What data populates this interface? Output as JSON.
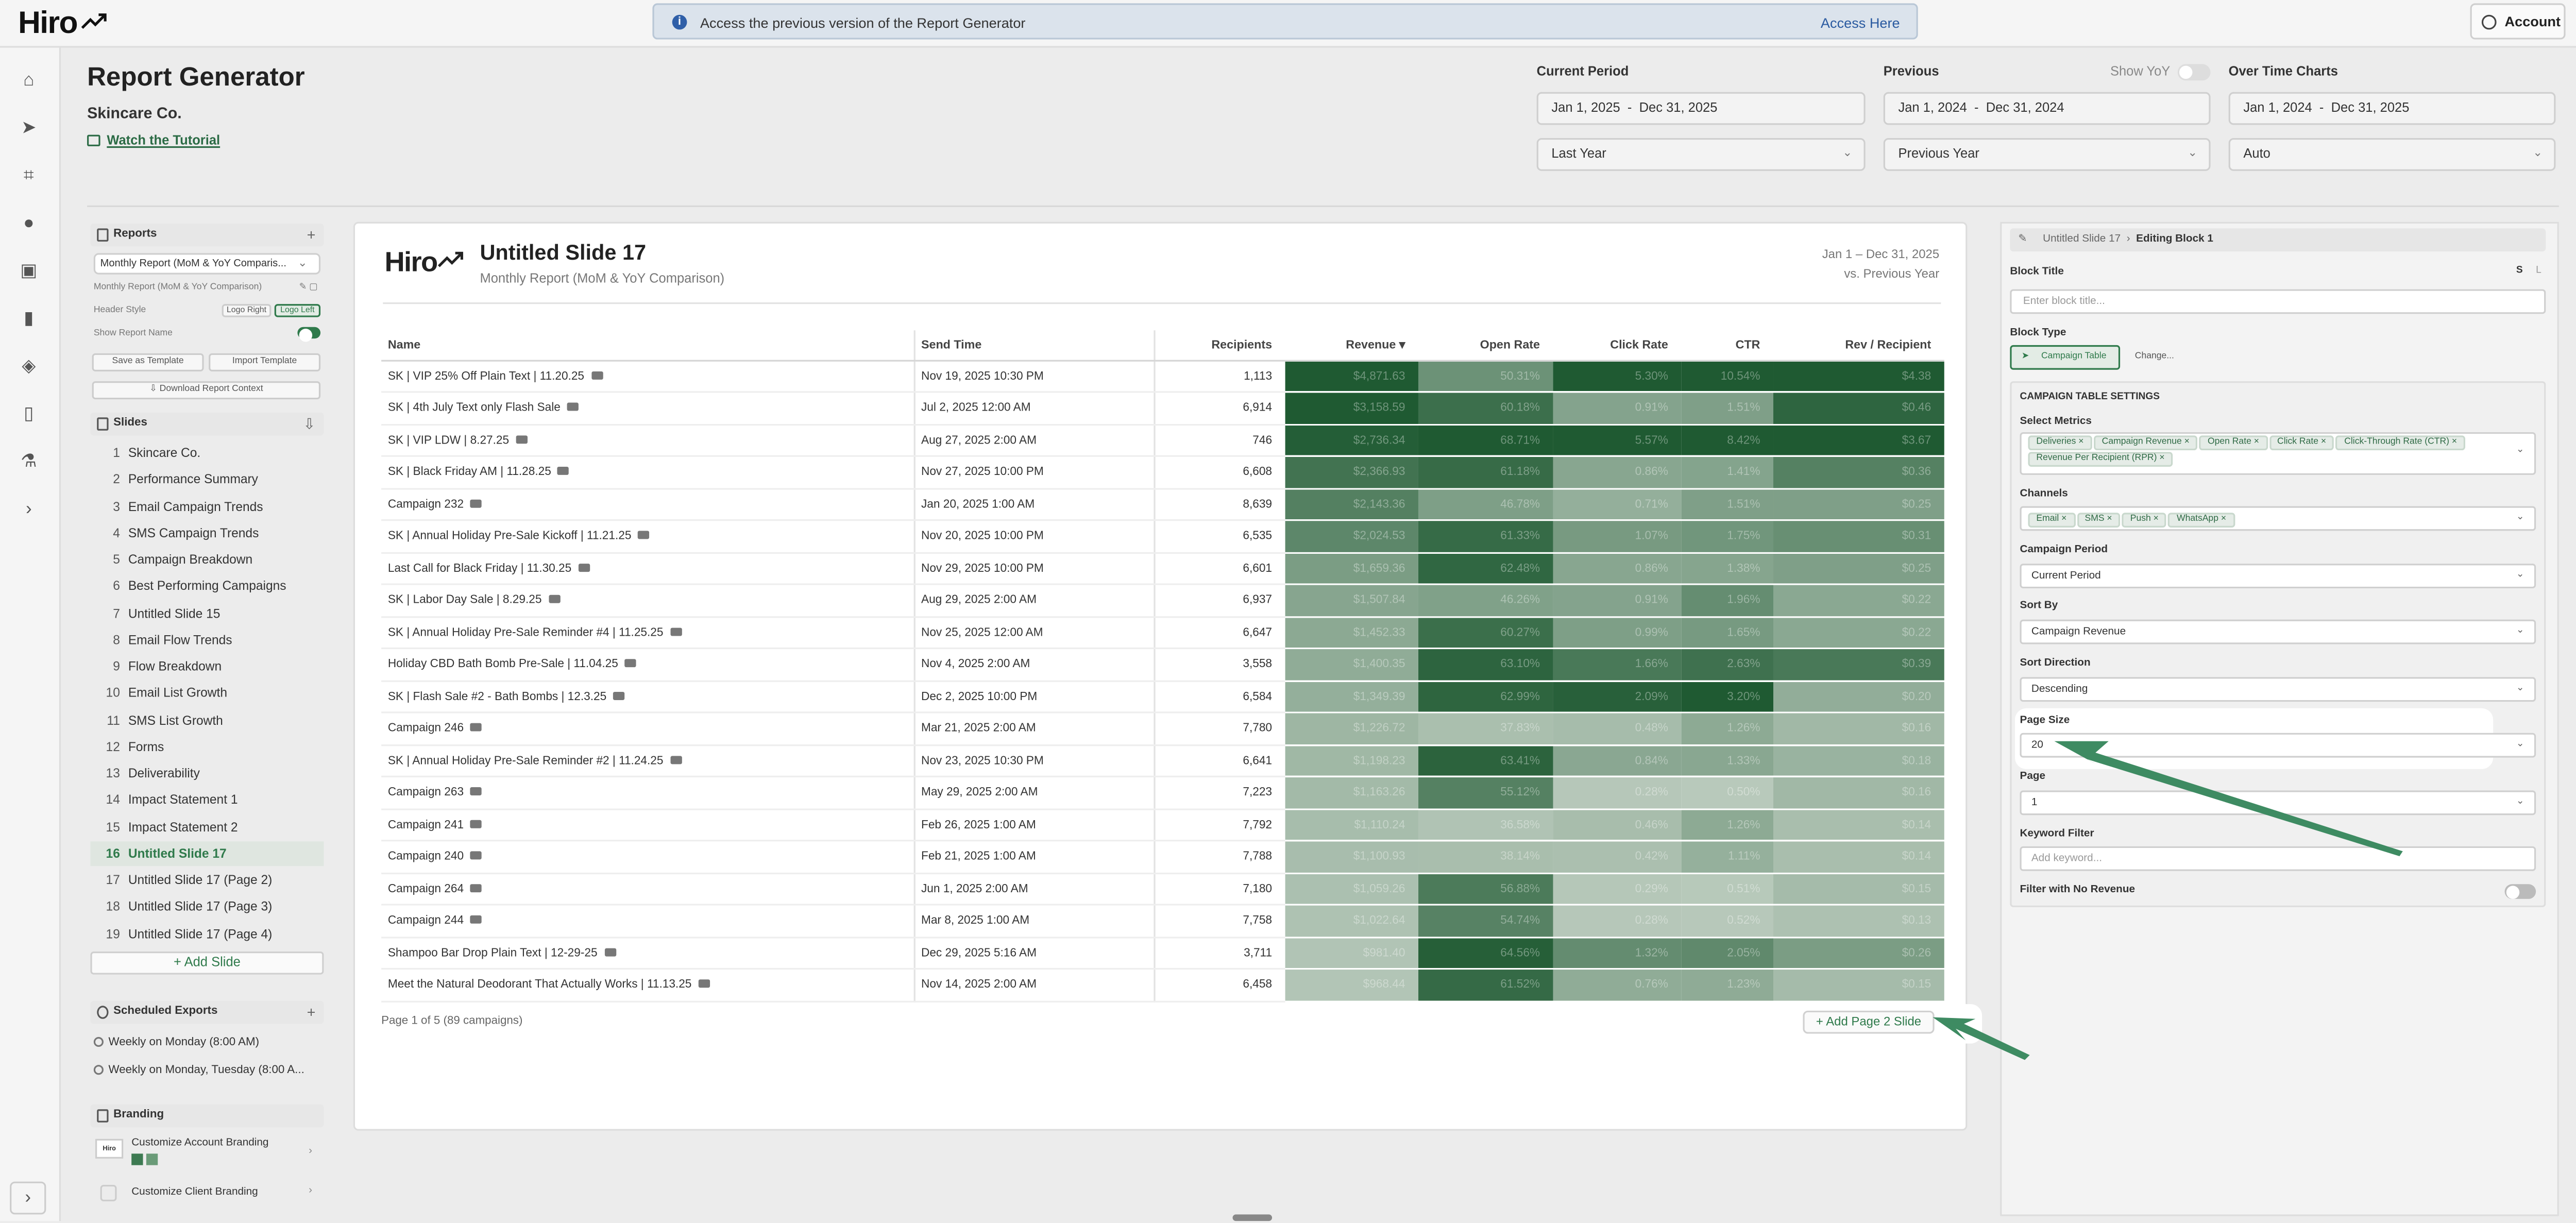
{
  "app": {
    "logo": "Hiro",
    "banner_text": "Access the previous version of the Report Generator",
    "banner_link": "Access Here",
    "account_label": "Account"
  },
  "header": {
    "title": "Report Generator",
    "company": "Skincare Co.",
    "tutorial": "Watch the Tutorial",
    "current_period": {
      "label": "Current Period",
      "start": "Jan 1, 2025",
      "end": "Dec 31, 2025",
      "preset": "Last Year"
    },
    "previous": {
      "label": "Previous",
      "show_yoy": "Show YoY",
      "start": "Jan 1, 2024",
      "end": "Dec 31, 2024",
      "preset": "Previous Year"
    },
    "over_time": {
      "label": "Over Time Charts",
      "start": "Jan 1, 2024",
      "end": "Dec 31, 2025",
      "preset": "Auto"
    }
  },
  "left": {
    "reports_label": "Reports",
    "report_select": "Monthly Report (MoM & YoY Comparis...",
    "report_sub": "Monthly Report (MoM & YoY Comparison)",
    "header_style": "Header Style",
    "logo_right": "Logo Right",
    "logo_left": "Logo Left",
    "show_report_name": "Show Report Name",
    "save_template": "Save as Template",
    "import_template": "Import Template",
    "download_context": "Download Report Context",
    "slides_label": "Slides",
    "slides": [
      {
        "n": "1",
        "label": "Skincare Co."
      },
      {
        "n": "2",
        "label": "Performance Summary"
      },
      {
        "n": "3",
        "label": "Email Campaign Trends"
      },
      {
        "n": "4",
        "label": "SMS Campaign Trends"
      },
      {
        "n": "5",
        "label": "Campaign Breakdown"
      },
      {
        "n": "6",
        "label": "Best Performing Campaigns"
      },
      {
        "n": "7",
        "label": "Untitled Slide 15"
      },
      {
        "n": "8",
        "label": "Email Flow Trends"
      },
      {
        "n": "9",
        "label": "Flow Breakdown"
      },
      {
        "n": "10",
        "label": "Email List Growth"
      },
      {
        "n": "11",
        "label": "SMS List Growth"
      },
      {
        "n": "12",
        "label": "Forms"
      },
      {
        "n": "13",
        "label": "Deliverability"
      },
      {
        "n": "14",
        "label": "Impact Statement 1"
      },
      {
        "n": "15",
        "label": "Impact Statement 2"
      },
      {
        "n": "16",
        "label": "Untitled Slide 17"
      },
      {
        "n": "17",
        "label": "Untitled Slide 17 (Page 2)"
      },
      {
        "n": "18",
        "label": "Untitled Slide 17 (Page 3)"
      },
      {
        "n": "19",
        "label": "Untitled Slide 17 (Page 4)"
      }
    ],
    "add_slide": "+ Add Slide",
    "scheduled_label": "Scheduled Exports",
    "exports": [
      "Weekly on Monday (8:00 AM)",
      "Weekly on Monday, Tuesday (8:00 A..."
    ],
    "branding_label": "Branding",
    "branding_items": [
      "Customize Account Branding",
      "Customize Client Branding"
    ]
  },
  "slide": {
    "logo": "Hiro",
    "title": "Untitled Slide 17",
    "subtitle": "Monthly Report (MoM & YoY Comparison)",
    "date_range": "Jan 1 – Dec 31, 2025",
    "compare": "vs. Previous Year",
    "columns": [
      "Name",
      "Send Time",
      "Recipients",
      "Revenue ▾",
      "Open Rate",
      "Click Rate",
      "CTR",
      "Rev / Recipient"
    ],
    "rows": [
      {
        "name": "SK | VIP 25% Off Plain Text | 11.20.25",
        "time": "Nov 19, 2025 10:30 PM",
        "rec": "1,113",
        "rev": "$4,871.63",
        "open": "50.31%",
        "click": "5.30%",
        "ctr": "10.54%",
        "rpr": "$4.38"
      },
      {
        "name": "SK | 4th July Text only Flash Sale",
        "time": "Jul 2, 2025 12:00 AM",
        "rec": "6,914",
        "rev": "$3,158.59",
        "open": "60.18%",
        "click": "0.91%",
        "ctr": "1.51%",
        "rpr": "$0.46"
      },
      {
        "name": "SK | VIP LDW | 8.27.25",
        "time": "Aug 27, 2025 2:00 AM",
        "rec": "746",
        "rev": "$2,736.34",
        "open": "68.71%",
        "click": "5.57%",
        "ctr": "8.42%",
        "rpr": "$3.67"
      },
      {
        "name": "SK | Black Friday AM | 11.28.25",
        "time": "Nov 27, 2025 10:00 PM",
        "rec": "6,608",
        "rev": "$2,366.93",
        "open": "61.18%",
        "click": "0.86%",
        "ctr": "1.41%",
        "rpr": "$0.36"
      },
      {
        "name": "Campaign 232",
        "time": "Jan 20, 2025 1:00 AM",
        "rec": "8,639",
        "rev": "$2,143.36",
        "open": "46.78%",
        "click": "0.71%",
        "ctr": "1.51%",
        "rpr": "$0.25"
      },
      {
        "name": "SK | Annual Holiday Pre-Sale Kickoff | 11.21.25",
        "time": "Nov 20, 2025 10:00 PM",
        "rec": "6,535",
        "rev": "$2,024.53",
        "open": "61.33%",
        "click": "1.07%",
        "ctr": "1.75%",
        "rpr": "$0.31"
      },
      {
        "name": "Last Call for Black Friday | 11.30.25",
        "time": "Nov 29, 2025 10:00 PM",
        "rec": "6,601",
        "rev": "$1,659.36",
        "open": "62.48%",
        "click": "0.86%",
        "ctr": "1.38%",
        "rpr": "$0.25"
      },
      {
        "name": "SK | Labor Day Sale | 8.29.25",
        "time": "Aug 29, 2025 2:00 AM",
        "rec": "6,937",
        "rev": "$1,507.84",
        "open": "46.26%",
        "click": "0.91%",
        "ctr": "1.96%",
        "rpr": "$0.22"
      },
      {
        "name": "SK | Annual Holiday Pre-Sale Reminder #4 | 11.25.25",
        "time": "Nov 25, 2025 12:00 AM",
        "rec": "6,647",
        "rev": "$1,452.33",
        "open": "60.27%",
        "click": "0.99%",
        "ctr": "1.65%",
        "rpr": "$0.22"
      },
      {
        "name": "Holiday CBD Bath Bomb Pre-Sale | 11.04.25",
        "time": "Nov 4, 2025 2:00 AM",
        "rec": "3,558",
        "rev": "$1,400.35",
        "open": "63.10%",
        "click": "1.66%",
        "ctr": "2.63%",
        "rpr": "$0.39"
      },
      {
        "name": "SK | Flash Sale #2 - Bath Bombs | 12.3.25",
        "time": "Dec 2, 2025 10:00 PM",
        "rec": "6,584",
        "rev": "$1,349.39",
        "open": "62.99%",
        "click": "2.09%",
        "ctr": "3.20%",
        "rpr": "$0.20"
      },
      {
        "name": "Campaign 246",
        "time": "Mar 21, 2025 2:00 AM",
        "rec": "7,780",
        "rev": "$1,226.72",
        "open": "37.83%",
        "click": "0.48%",
        "ctr": "1.26%",
        "rpr": "$0.16"
      },
      {
        "name": "SK | Annual Holiday Pre-Sale Reminder #2 | 11.24.25",
        "time": "Nov 23, 2025 10:30 PM",
        "rec": "6,641",
        "rev": "$1,198.23",
        "open": "63.41%",
        "click": "0.84%",
        "ctr": "1.33%",
        "rpr": "$0.18"
      },
      {
        "name": "Campaign 263",
        "time": "May 29, 2025 2:00 AM",
        "rec": "7,223",
        "rev": "$1,163.26",
        "open": "55.12%",
        "click": "0.28%",
        "ctr": "0.50%",
        "rpr": "$0.16"
      },
      {
        "name": "Campaign 241",
        "time": "Feb 26, 2025 1:00 AM",
        "rec": "7,792",
        "rev": "$1,110.24",
        "open": "36.58%",
        "click": "0.46%",
        "ctr": "1.26%",
        "rpr": "$0.14"
      },
      {
        "name": "Campaign 240",
        "time": "Feb 21, 2025 1:00 AM",
        "rec": "7,788",
        "rev": "$1,100.93",
        "open": "38.14%",
        "click": "0.42%",
        "ctr": "1.11%",
        "rpr": "$0.14"
      },
      {
        "name": "Campaign 264",
        "time": "Jun 1, 2025 2:00 AM",
        "rec": "7,180",
        "rev": "$1,059.26",
        "open": "56.88%",
        "click": "0.29%",
        "ctr": "0.51%",
        "rpr": "$0.15"
      },
      {
        "name": "Campaign 244",
        "time": "Mar 8, 2025 1:00 AM",
        "rec": "7,758",
        "rev": "$1,022.64",
        "open": "54.74%",
        "click": "0.28%",
        "ctr": "0.52%",
        "rpr": "$0.13"
      },
      {
        "name": "Shampoo Bar Drop Plain Text | 12-29-25",
        "time": "Dec 29, 2025 5:16 AM",
        "rec": "3,711",
        "rev": "$981.40",
        "open": "64.56%",
        "click": "1.32%",
        "ctr": "2.05%",
        "rpr": "$0.26"
      },
      {
        "name": "Meet the Natural Deodorant That Actually Works | 11.13.25",
        "time": "Nov 14, 2025 2:00 AM",
        "rec": "6,458",
        "rev": "$968.44",
        "open": "61.52%",
        "click": "0.76%",
        "ctr": "1.23%",
        "rpr": "$0.15"
      }
    ],
    "page_info": "Page 1 of 5 (89 campaigns)",
    "add_page": "+ Add Page 2 Slide"
  },
  "right": {
    "breadcrumb_parent": "Untitled Slide 17",
    "breadcrumb_current": "Editing Block 1",
    "block_title_label": "Block Title",
    "block_title_placeholder": "Enter block title...",
    "size_s": "S",
    "size_l": "L",
    "block_type_label": "Block Type",
    "block_type": "Campaign Table",
    "change": "Change...",
    "settings_title": "CAMPAIGN TABLE SETTINGS",
    "metrics_label": "Select Metrics",
    "metrics": [
      "Deliveries ×",
      "Campaign Revenue ×",
      "Open Rate ×",
      "Click Rate ×",
      "Click-Through Rate (CTR) ×",
      "Revenue Per Recipient (RPR) ×"
    ],
    "channels_label": "Channels",
    "channels": [
      "Email ×",
      "SMS ×",
      "Push ×",
      "WhatsApp ×"
    ],
    "campaign_period_label": "Campaign Period",
    "campaign_period": "Current Period",
    "sort_by_label": "Sort By",
    "sort_by": "Campaign Revenue",
    "sort_dir_label": "Sort Direction",
    "sort_dir": "Descending",
    "page_size_label": "Page Size",
    "page_size": "20",
    "page_label": "Page",
    "page": "1",
    "keyword_label": "Keyword Filter",
    "keyword_placeholder": "Add keyword...",
    "no_revenue_label": "Filter with No Revenue"
  },
  "colors": {
    "accent": "#2f7a4b",
    "heat_dark": "#1f5a32",
    "heat_mid": "#4f8a5e",
    "heat_light": "#b8c9bb",
    "arrow": "#3e8b62"
  }
}
